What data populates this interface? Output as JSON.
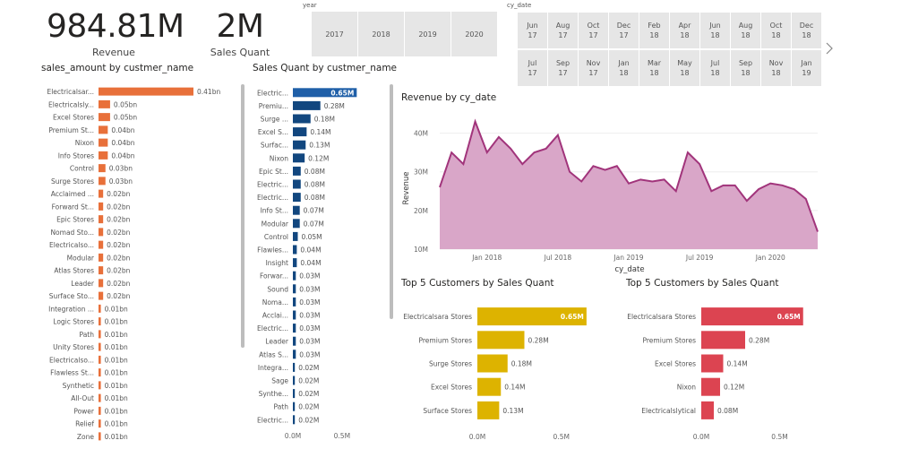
{
  "kpis": {
    "revenue": {
      "value": "984.81M",
      "label": "Revenue"
    },
    "sales_quant": {
      "value": "2M",
      "label": "Sales Quant"
    }
  },
  "slicers": {
    "year": {
      "title": "year",
      "options": [
        "2017",
        "2018",
        "2019",
        "2020"
      ]
    },
    "cy_date": {
      "title": "cy_date",
      "row1": [
        [
          "Jun",
          "17"
        ],
        [
          "Aug",
          "17"
        ],
        [
          "Oct",
          "17"
        ],
        [
          "Dec",
          "17"
        ],
        [
          "Feb",
          "18"
        ],
        [
          "Apr",
          "18"
        ],
        [
          "Jun",
          "18"
        ],
        [
          "Aug",
          "18"
        ],
        [
          "Oct",
          "18"
        ],
        [
          "Dec",
          "18"
        ]
      ],
      "row2": [
        [
          "Jul",
          "17"
        ],
        [
          "Sep",
          "17"
        ],
        [
          "Nov",
          "17"
        ],
        [
          "Jan",
          "18"
        ],
        [
          "Mar",
          "18"
        ],
        [
          "May",
          "18"
        ],
        [
          "Jul",
          "18"
        ],
        [
          "Sep",
          "18"
        ],
        [
          "Nov",
          "18"
        ],
        [
          "Jan",
          "19"
        ]
      ],
      "next_icon": "chevron-right-icon"
    }
  },
  "chart_data": [
    {
      "id": "sales_amount",
      "type": "bar",
      "title": "sales_amount by custmer_name",
      "color": "#E8703A",
      "xlim": [
        0,
        0.41
      ],
      "categories": [
        "Electricalsar...",
        "Electricalsly...",
        "Excel Stores",
        "Premium St...",
        "Nixon",
        "Info Stores",
        "Control",
        "Surge Stores",
        "Acclaimed ...",
        "Forward St...",
        "Epic Stores",
        "Nomad Sto...",
        "Electricalso...",
        "Modular",
        "Atlas Stores",
        "Leader",
        "Surface Sto...",
        "Integration ...",
        "Logic Stores",
        "Path",
        "Unity Stores",
        "Electricalso...",
        "Flawless St...",
        "Synthetic",
        "All-Out",
        "Power",
        "Relief",
        "Zone"
      ],
      "values": [
        0.41,
        0.05,
        0.05,
        0.04,
        0.04,
        0.04,
        0.03,
        0.03,
        0.02,
        0.02,
        0.02,
        0.02,
        0.02,
        0.02,
        0.02,
        0.02,
        0.02,
        0.01,
        0.01,
        0.01,
        0.01,
        0.01,
        0.01,
        0.01,
        0.01,
        0.01,
        0.01,
        0.01
      ],
      "labels": [
        "0.41bn",
        "0.05bn",
        "0.05bn",
        "0.04bn",
        "0.04bn",
        "0.04bn",
        "0.03bn",
        "0.03bn",
        "0.02bn",
        "0.02bn",
        "0.02bn",
        "0.02bn",
        "0.02bn",
        "0.02bn",
        "0.02bn",
        "0.02bn",
        "0.02bn",
        "0.01bn",
        "0.01bn",
        "0.01bn",
        "0.01bn",
        "0.01bn",
        "0.01bn",
        "0.01bn",
        "0.01bn",
        "0.01bn",
        "0.01bn",
        "0.01bn"
      ]
    },
    {
      "id": "sales_quant",
      "type": "bar",
      "title": "Sales Quant by custmer_name",
      "color": "#12477F",
      "highlight_color": "#1F5FA8",
      "xlim": [
        0,
        0.72
      ],
      "ticks": [
        "0.0M",
        "0.5M"
      ],
      "tick_values": [
        0,
        0.5
      ],
      "categories": [
        "Electric...",
        "Premiu...",
        "Surge ...",
        "Excel S...",
        "Surfac...",
        "Nixon",
        "Epic St...",
        "Electric...",
        "Electric...",
        "Info St...",
        "Modular",
        "Control",
        "Flawles...",
        "Insight",
        "Forwar...",
        "Sound",
        "Noma...",
        "Acclai...",
        "Electric...",
        "Leader",
        "Atlas S...",
        "Integra...",
        "Sage",
        "Synthe...",
        "Path",
        "Electric..."
      ],
      "values": [
        0.65,
        0.28,
        0.18,
        0.14,
        0.13,
        0.12,
        0.08,
        0.08,
        0.08,
        0.07,
        0.07,
        0.05,
        0.04,
        0.04,
        0.03,
        0.03,
        0.03,
        0.03,
        0.03,
        0.03,
        0.03,
        0.02,
        0.02,
        0.02,
        0.02,
        0.02
      ],
      "labels": [
        "0.65M",
        "0.28M",
        "0.18M",
        "0.14M",
        "0.13M",
        "0.12M",
        "0.08M",
        "0.08M",
        "0.08M",
        "0.07M",
        "0.07M",
        "0.05M",
        "0.04M",
        "0.04M",
        "0.03M",
        "0.03M",
        "0.03M",
        "0.03M",
        "0.03M",
        "0.03M",
        "0.03M",
        "0.02M",
        "0.02M",
        "0.02M",
        "0.02M",
        "0.02M"
      ]
    },
    {
      "id": "revenue_by_date",
      "type": "area",
      "title": "Revenue by cy_date",
      "xlabel": "cy_date",
      "ylabel": "Revenue",
      "color": "#A1347B",
      "fill": "#D9A6C8",
      "ylim": [
        10,
        45
      ],
      "yticks": [
        10,
        20,
        30,
        40
      ],
      "ytick_labels": [
        "10M",
        "20M",
        "30M",
        "40M"
      ],
      "xticks": [
        "Jan 2018",
        "Jul 2018",
        "Jan 2019",
        "Jul 2019",
        "Jan 2020"
      ],
      "xtick_index": [
        4,
        10,
        16,
        22,
        28
      ],
      "values": [
        26,
        35,
        32,
        43,
        35,
        39,
        36,
        32,
        35,
        36,
        39.5,
        30,
        27.5,
        31.5,
        30.5,
        31.5,
        27,
        28,
        27.5,
        28,
        25,
        35,
        32,
        25,
        26.5,
        26.5,
        22.5,
        25.5,
        27,
        26.5,
        25.5,
        23,
        14.5
      ]
    },
    {
      "id": "top5_quant_1",
      "type": "bar",
      "title": "Top 5 Customers by Sales Quant",
      "color": "#DDB300",
      "xlim": [
        0,
        0.72
      ],
      "ticks": [
        "0.0M",
        "0.5M"
      ],
      "tick_values": [
        0,
        0.5
      ],
      "categories": [
        "Electricalsara Stores",
        "Premium Stores",
        "Surge Stores",
        "Excel Stores",
        "Surface Stores"
      ],
      "values": [
        0.65,
        0.28,
        0.18,
        0.14,
        0.13
      ],
      "labels": [
        "0.65M",
        "0.28M",
        "0.18M",
        "0.14M",
        "0.13M"
      ]
    },
    {
      "id": "top5_quant_2",
      "type": "bar",
      "title": "Top 5 Customers by Sales Quant",
      "color": "#DC4451",
      "xlim": [
        0,
        0.72
      ],
      "ticks": [
        "0.0M",
        "0.5M"
      ],
      "tick_values": [
        0,
        0.5
      ],
      "categories": [
        "Electricalsara Stores",
        "Premium Stores",
        "Excel Stores",
        "Nixon",
        "Electricalslytical"
      ],
      "values": [
        0.65,
        0.28,
        0.14,
        0.12,
        0.08
      ],
      "labels": [
        "0.65M",
        "0.28M",
        "0.14M",
        "0.12M",
        "0.08M"
      ]
    }
  ]
}
